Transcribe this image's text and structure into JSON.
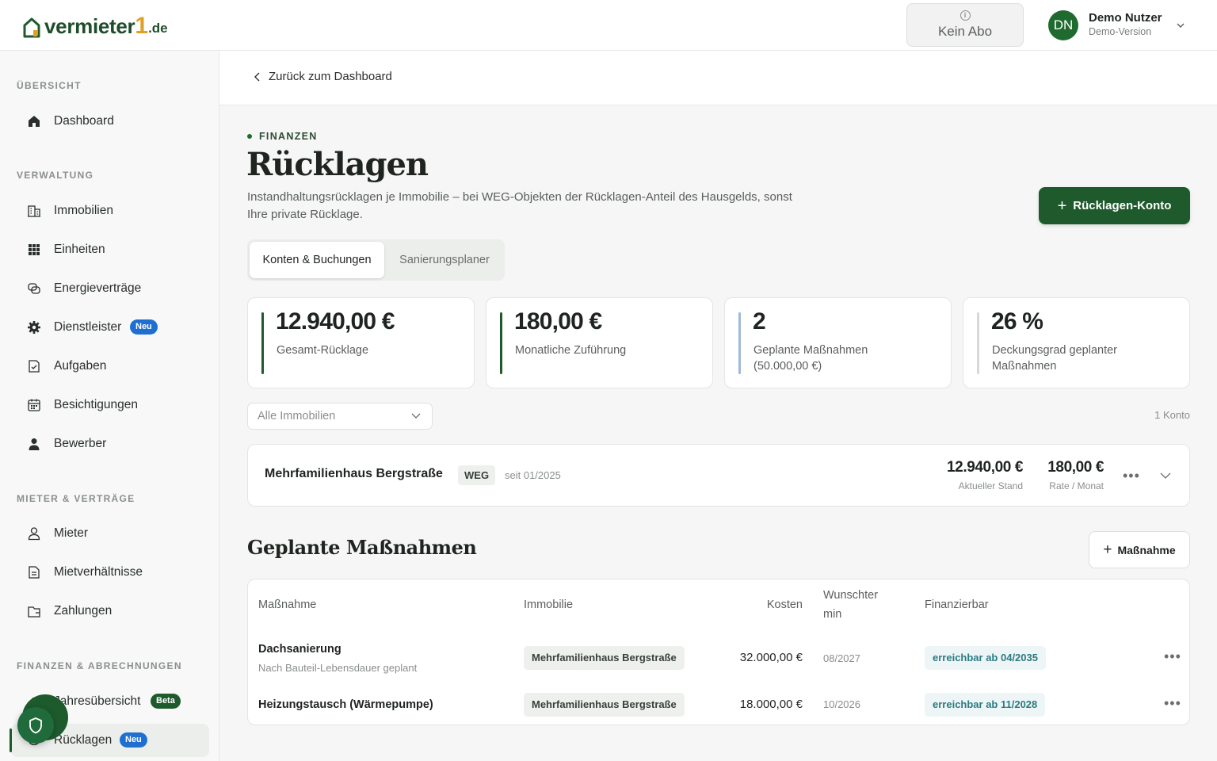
{
  "brand": {
    "name": "vermieter",
    "one": "1",
    "tld": ".de"
  },
  "header": {
    "abo_label": "Kein Abo",
    "user": {
      "initials": "DN",
      "name": "Demo Nutzer",
      "subtitle": "Demo-Version"
    }
  },
  "sidebar": {
    "sections": [
      {
        "title": "ÜBERSICHT"
      },
      {
        "title": "VERWALTUNG"
      },
      {
        "title": "MIETER & VERTRÄGE"
      },
      {
        "title": "FINANZEN & ABRECHNUNGEN"
      }
    ],
    "items": [
      {
        "label": "Dashboard",
        "icon": "home-icon"
      },
      {
        "label": "Immobilien",
        "icon": "building-icon"
      },
      {
        "label": "Einheiten",
        "icon": "grid-icon"
      },
      {
        "label": "Energieverträge",
        "icon": "energy-icon"
      },
      {
        "label": "Dienstleister",
        "icon": "gear-icon",
        "badge": "Neu"
      },
      {
        "label": "Aufgaben",
        "icon": "task-icon"
      },
      {
        "label": "Besichtigungen",
        "icon": "calendar-icon"
      },
      {
        "label": "Bewerber",
        "icon": "person-filled-icon"
      },
      {
        "label": "Mieter",
        "icon": "person-icon"
      },
      {
        "label": "Mietverhältnisse",
        "icon": "document-icon"
      },
      {
        "label": "Zahlungen",
        "icon": "wallet-icon"
      },
      {
        "label": "Jahresübersicht",
        "icon": "chart-icon",
        "badge": "Beta"
      },
      {
        "label": "Rücklagen",
        "icon": "piggy-bank-icon",
        "badge": "Neu",
        "active": true
      }
    ]
  },
  "main": {
    "back_label": "Zurück zum Dashboard",
    "kicker": "FINANZEN",
    "title": "Rücklagen",
    "description": "Instandhaltungsrücklagen je Immobilie – bei WEG-Objekten der Rücklagen-Anteil des Hausgelds, sonst Ihre private Rücklage.",
    "primary_button": "Rücklagen-Konto",
    "tabs": [
      {
        "label": "Konten & Buchungen",
        "active": true
      },
      {
        "label": "Sanierungsplaner",
        "active": false
      }
    ],
    "kpis": [
      {
        "value": "12.940,00 €",
        "label": "Gesamt-Rücklage",
        "accent": "#1f5a2c"
      },
      {
        "value": "180,00 €",
        "label": "Monatliche Zuführung",
        "accent": "#1f5a2c"
      },
      {
        "value": "2",
        "label": "Geplante Maßnahmen (50.000,00 €)",
        "accent": "#9fb9d9"
      },
      {
        "value": "26 %",
        "label": "Deckungsgrad geplanter Maßnahmen",
        "accent": "#d6d9d6"
      }
    ],
    "filter": {
      "placeholder": "Alle Immobilien"
    },
    "count_label": "1 Konto",
    "account": {
      "name": "Mehrfamilienhaus Bergstraße",
      "badge": "WEG",
      "since": "seit 01/2025",
      "balance": "12.940,00 €",
      "balance_label": "Aktueller Stand",
      "rate": "180,00 €",
      "rate_label": "Rate / Monat"
    },
    "measures": {
      "heading": "Geplante Maßnahmen",
      "add_button": "Maßnahme",
      "columns": {
        "measure": "Maßnahme",
        "property": "Immobilie",
        "cost": "Kosten",
        "date": "Wunschtermin",
        "finance": "Finanzierbar"
      },
      "rows": [
        {
          "title": "Dachsanierung",
          "subtitle": "Nach Bauteil-Lebensdauer geplant",
          "property": "Mehrfamilienhaus Bergstraße",
          "cost": "32.000,00 €",
          "date": "08/2027",
          "finance": "erreichbar ab 04/2035"
        },
        {
          "title": "Heizungstausch (Wärmepumpe)",
          "subtitle": "",
          "property": "Mehrfamilienhaus Bergstraße",
          "cost": "18.000,00 €",
          "date": "10/2026",
          "finance": "erreichbar ab 11/2028"
        }
      ]
    }
  },
  "colors": {
    "brand_green": "#1f5a2c",
    "accent_gold": "#e0a021",
    "badge_blue": "#1f6fd1",
    "finance_teal": "#2c7b82"
  }
}
